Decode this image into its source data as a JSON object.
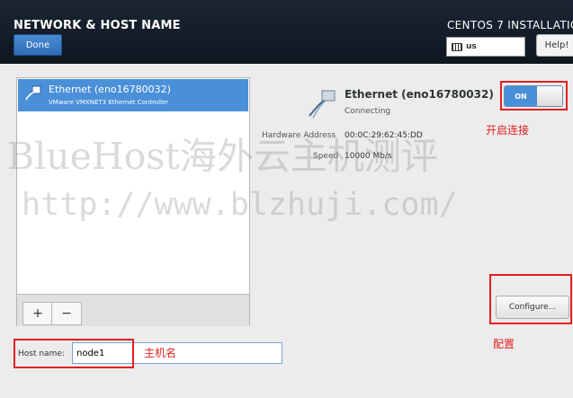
{
  "header": {
    "title": "NETWORK & HOST NAME",
    "done_label": "Done",
    "product": "CENTOS 7 INSTALLATIO",
    "keyboard_layout": "us",
    "help_label": "Help!"
  },
  "devices": [
    {
      "name": "Ethernet (eno16780032)",
      "subtitle": "VMware VMXNET3 Ethernet Controller"
    }
  ],
  "list_toolbar": {
    "add_label": "+",
    "remove_label": "−"
  },
  "detail": {
    "name": "Ethernet (eno16780032)",
    "status": "Connecting",
    "toggle_label": "ON",
    "hw_label": "Hardware Address",
    "hw_value": "00:0C:29:62:45:DD",
    "speed_label": "Speed",
    "speed_value": "10000 Mb/s",
    "configure_label": "Configure..."
  },
  "hostname": {
    "label": "Host name:",
    "value": "node1"
  },
  "annotations": {
    "toggle_note": "开启连接",
    "configure_note": "配置",
    "hostname_note": "主机名"
  },
  "watermark": {
    "line1": "BlueHost海外云主机测评",
    "line2": "http://www.blzhuji.com/"
  }
}
